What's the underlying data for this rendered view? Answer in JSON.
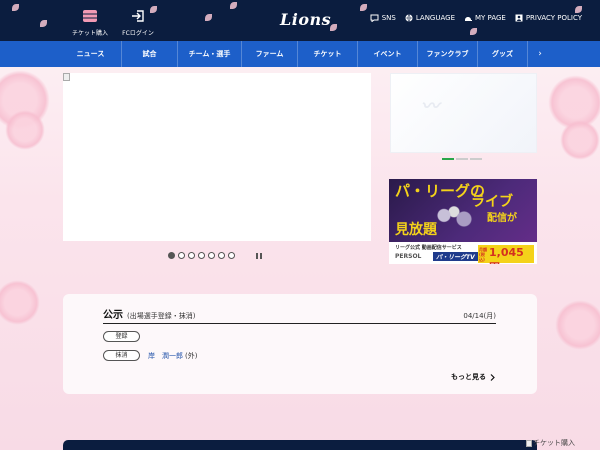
{
  "header": {
    "ticket_label": "チケット購入",
    "fc_login_label": "FCログイン",
    "logo_text": "Lions",
    "links": [
      {
        "label": "SNS",
        "icon": "chat-bubble-icon"
      },
      {
        "label": "LANGUAGE",
        "icon": "globe-icon"
      },
      {
        "label": "MY PAGE",
        "icon": "helmet-icon"
      },
      {
        "label": "PRIVACY POLICY",
        "icon": "person-badge-icon"
      }
    ]
  },
  "nav": {
    "items": [
      "ニュース",
      "試合",
      "チーム・選手",
      "ファーム",
      "チケット",
      "イベント",
      "ファンクラブ",
      "グッズ"
    ],
    "more_arrow": "›"
  },
  "hero": {
    "slide_count": 7,
    "active_slide": 1
  },
  "side_carousel": {
    "dot_count": 3,
    "active_dot": 1
  },
  "ad": {
    "headline_1": "パ・リーグの",
    "headline_2": "ライブ",
    "headline_3": "配信が",
    "headline_4": "見放題",
    "service_label": "リーグ公式 動画配信サービス",
    "brand_1": "PERSOL",
    "brand_2": "パ・リーグTV",
    "price_tag": "月額(税込)",
    "price": "1,045円~"
  },
  "announcement": {
    "title": "公示",
    "subtitle": "(出場選手登録・抹消)",
    "date": "04/14(月)",
    "registered_label": "登録",
    "deleted_label": "抹消",
    "player_name": "岸　潤一郎",
    "player_position": "(外)",
    "more_label": "もっと見る"
  },
  "floating": {
    "ticket_alt": "チケット購入"
  },
  "colors": {
    "header_bg": "#0b1d3f",
    "nav_bg": "#1d5fc9",
    "accent_green": "#2aa64a",
    "link_blue": "#1d4fa8"
  }
}
